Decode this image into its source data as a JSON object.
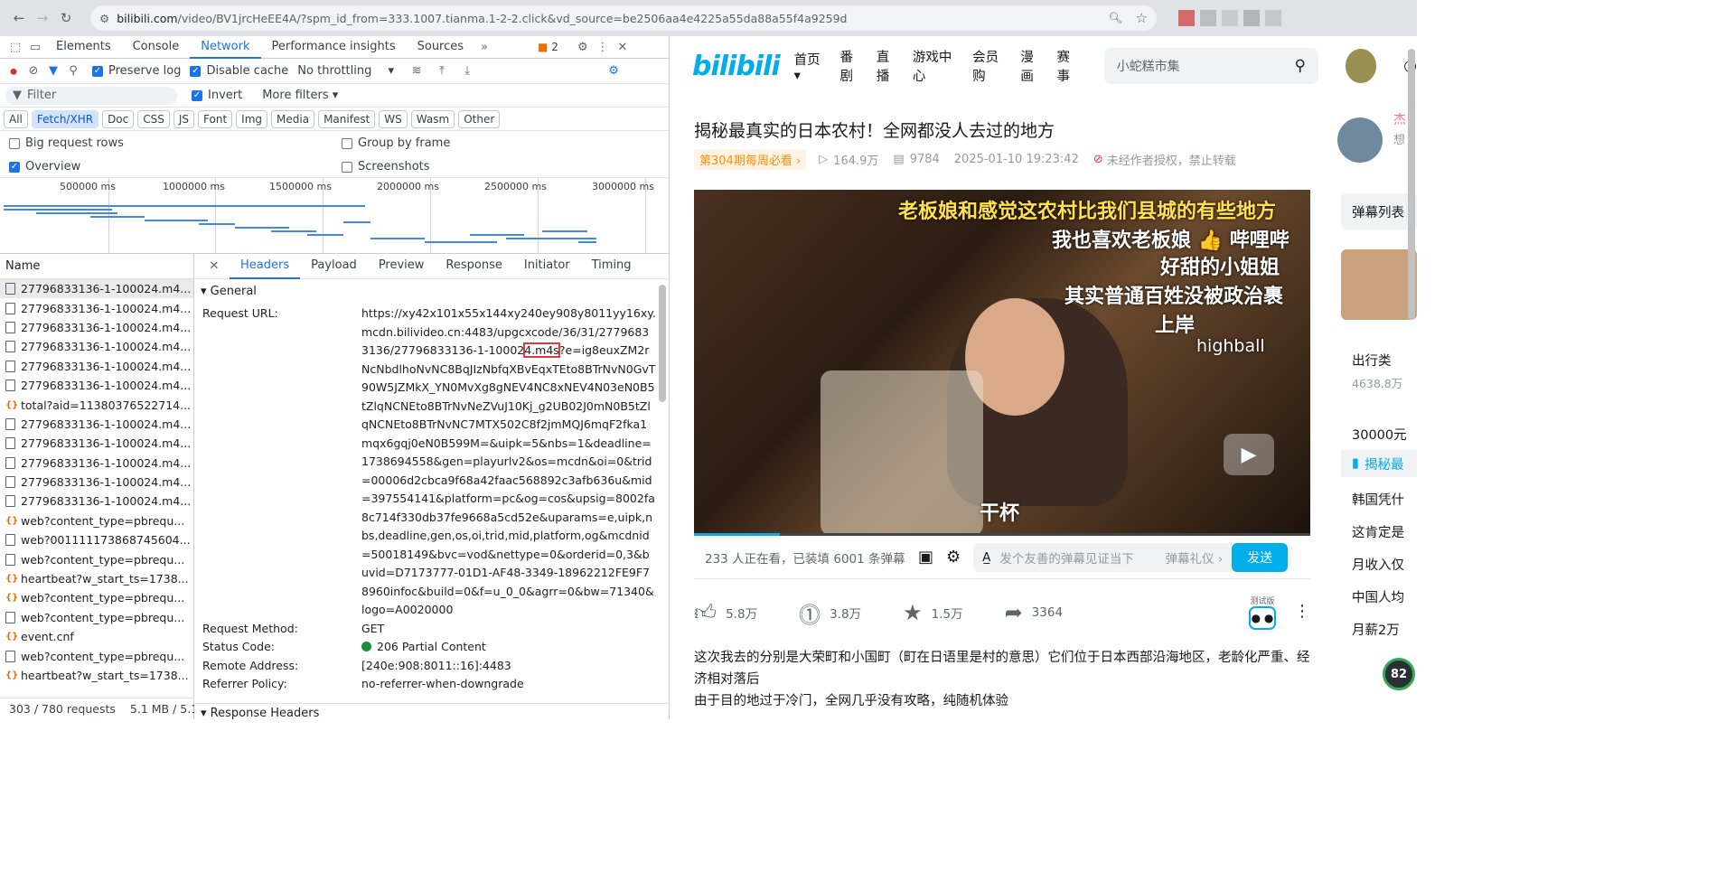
{
  "browser": {
    "url_domain": "bilibili.com",
    "url_path": "/video/BV1jrcHeEE4A/?spm_id_from=333.1007.tianma.1-2-2.click&vd_source=be2506aa4e4225a55da88a55f4a9259d"
  },
  "devtools": {
    "tabs": [
      "Elements",
      "Console",
      "Network",
      "Performance insights",
      "Sources"
    ],
    "active_tab": "Network",
    "issues_count": "2",
    "toolbar": {
      "preserve_log": "Preserve log",
      "disable_cache": "Disable cache",
      "throttling": "No throttling"
    },
    "filter_placeholder": "Filter",
    "invert": "Invert",
    "more_filters": "More filters",
    "types": [
      "All",
      "Fetch/XHR",
      "Doc",
      "CSS",
      "JS",
      "Font",
      "Img",
      "Media",
      "Manifest",
      "WS",
      "Wasm",
      "Other"
    ],
    "active_type": "Fetch/XHR",
    "options": {
      "big_rows": "Big request rows",
      "group_by_frame": "Group by frame",
      "overview": "Overview",
      "screenshots": "Screenshots"
    },
    "timeline_ticks": [
      "500000 ms",
      "1000000 ms",
      "1500000 ms",
      "2000000 ms",
      "2500000 ms",
      "3000000 ms"
    ],
    "list_header": "Name",
    "requests": [
      {
        "name": "27796833136-1-100024.m4...",
        "kind": "file"
      },
      {
        "name": "27796833136-1-100024.m4...",
        "kind": "file"
      },
      {
        "name": "27796833136-1-100024.m4...",
        "kind": "file"
      },
      {
        "name": "27796833136-1-100024.m4...",
        "kind": "file"
      },
      {
        "name": "27796833136-1-100024.m4...",
        "kind": "file"
      },
      {
        "name": "27796833136-1-100024.m4...",
        "kind": "file"
      },
      {
        "name": "total?aid=11380376522714...",
        "kind": "xhr"
      },
      {
        "name": "27796833136-1-100024.m4...",
        "kind": "file"
      },
      {
        "name": "27796833136-1-100024.m4...",
        "kind": "file"
      },
      {
        "name": "27796833136-1-100024.m4...",
        "kind": "file"
      },
      {
        "name": "27796833136-1-100024.m4...",
        "kind": "file"
      },
      {
        "name": "27796833136-1-100024.m4...",
        "kind": "file"
      },
      {
        "name": "web?content_type=pbrequ...",
        "kind": "xhr"
      },
      {
        "name": "web?001111173868745604...",
        "kind": "file"
      },
      {
        "name": "web?content_type=pbrequ...",
        "kind": "file"
      },
      {
        "name": "heartbeat?w_start_ts=1738...",
        "kind": "xhr"
      },
      {
        "name": "web?content_type=pbrequ...",
        "kind": "xhr"
      },
      {
        "name": "web?content_type=pbrequ...",
        "kind": "file"
      },
      {
        "name": "event.cnf",
        "kind": "xhr"
      },
      {
        "name": "web?content_type=pbrequ...",
        "kind": "file"
      },
      {
        "name": "heartbeat?w_start_ts=1738...",
        "kind": "xhr"
      }
    ],
    "footer_requests": "303 / 780 requests",
    "footer_size": "5.1 MB / 5.1",
    "detail_tabs": [
      "Headers",
      "Payload",
      "Preview",
      "Response",
      "Initiator",
      "Timing"
    ],
    "active_detail_tab": "Headers",
    "general_label": "General",
    "response_headers_label": "Response Headers",
    "general": {
      "request_url_label": "Request URL:",
      "request_url_pre": "https://xy42x101x55x144xy240ey908y8011yy16xy.mcdn.bilivideo.cn:4483/upgcxcode/36/31/27796833136/27796833136-1-10002",
      "request_url_hl": "4.m4s",
      "request_url_post": "?e=ig8euxZM2rNcNbdlhoNvNC8BqJIzNbfqXBvEqxTEto8BTrNvN0GvT90W5JZMkX_YN0MvXg8gNEV4NC8xNEV4N03eN0B5tZlqNCNEto8BTrNvNeZVuJ10Kj_g2UB02J0mN0B5tZlqNCNEto8BTrNvNC7MTX502C8f2jmMQJ6mqF2fka1mqx6gqj0eN0B599M=&uipk=5&nbs=1&deadline=1738694558&gen=playurlv2&os=mcdn&oi=0&trid=00006d2cbca9f68a42faac568892c3afb636u&mid=397554141&platform=pc&og=cos&upsig=8002fa8c714f330db37fe9668a5cd52e&uparams=e,uipk,nbs,deadline,gen,os,oi,trid,mid,platform,og&mcdnid=50018149&bvc=vod&nettype=0&orderid=0,3&buvid=D7173777-01D1-AF48-3349-18962212FE9F78960infoc&build=0&f=u_0_0&agrr=0&bw=71340&logo=A0020000",
      "method_label": "Request Method:",
      "method": "GET",
      "status_label": "Status Code:",
      "status": "206 Partial Content",
      "remote_label": "Remote Address:",
      "remote": "[240e:908:8011::16]:4483",
      "referrer_label": "Referrer Policy:",
      "referrer": "no-referrer-when-downgrade"
    }
  },
  "bilibili": {
    "logo": "bilibili",
    "nav": [
      "首页",
      "番剧",
      "直播",
      "游戏中心",
      "会员购",
      "漫画",
      "赛事"
    ],
    "search_placeholder": "小蛇糕市集",
    "video_title": "揭秘最真实的日本农村！全网都没人去过的地方",
    "weekly_badge": "第304期每周必看",
    "views": "164.9万",
    "danmaku_count": "9784",
    "datetime": "2025-01-10 19:23:42",
    "copyright": "未经作者授权，禁止转载",
    "danmaku_overlay": [
      "老板娘和感觉这农村比我们县城的有些地方",
      "我也喜欢老板娘 👍 哔哩哔",
      "好甜的小姐姐",
      "其实普通百姓没被政治裹",
      "上岸",
      "highball",
      "干杯"
    ],
    "watching": "233 人正在看，已装填 6001 条弹幕",
    "danmaku_input_placeholder": "发个友善的弹幕见证当下",
    "danmaku_etiquette": "弹幕礼仪",
    "send": "发送",
    "test_label": "测试版",
    "likes": "5.8万",
    "coins": "3.8万",
    "favorites": "1.5万",
    "shares": "3364",
    "description": [
      "这次我去的分别是大荣町和小国町（町在日语里是村的意思）它们位于日本西部沿海地区，老龄化严重、经济相对落后",
      "由于目的地过于冷门，全网几乎没有攻略，纯随机体验"
    ],
    "sidebar": {
      "danmaku_list": "弹幕列表",
      "travel": "出行类",
      "travel_count": "4638.8万",
      "items": [
        "30000元",
        "揭秘最",
        "韩国凭什",
        "这肯定是",
        "月收入仅",
        "中国人均",
        "月薪2万"
      ],
      "author_label": "杰",
      "author_sub": "想",
      "fps": "82"
    }
  },
  "colors": {
    "accent": "#1a73e8",
    "bili_blue": "#00aeec",
    "status_green": "#1e8e3e"
  }
}
